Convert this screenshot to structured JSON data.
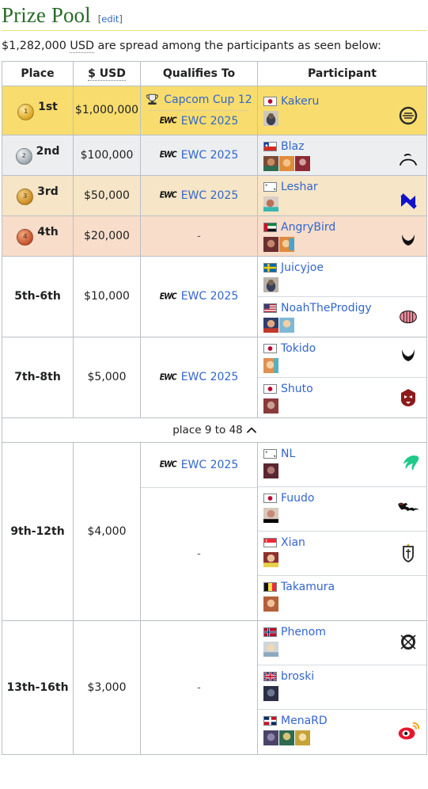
{
  "heading": {
    "title": "Prize Pool",
    "edit_open": "[",
    "edit_label": "edit",
    "edit_close": "]"
  },
  "intro": {
    "amount": "$1,282,000",
    "currency_abbr": "USD",
    "text_after": " are spread among the participants as seen below:"
  },
  "table": {
    "headers": {
      "place": "Place",
      "usd": "$ USD",
      "qualifies": "Qualifies To",
      "participant": "Participant"
    },
    "rows": [
      {
        "place": "1st",
        "medal": "gold-medal-icon",
        "prize": "$1,000,000",
        "qualifies": [
          {
            "label": "Capcom Cup 12",
            "icon": "trophy-icon"
          },
          {
            "label": "EWC 2025",
            "icon": "ewc-icon"
          }
        ],
        "participants": [
          {
            "name": "Kakeru",
            "flag": "japan-flag",
            "team_logo": "tsm-ring-logo",
            "characters": 1
          }
        ]
      },
      {
        "place": "2nd",
        "medal": "silver-medal-icon",
        "prize": "$100,000",
        "qualifies": [
          {
            "label": "EWC 2025",
            "icon": "ewc-icon"
          }
        ],
        "participants": [
          {
            "name": "Blaz",
            "flag": "chile-flag",
            "team_logo": "arc-logo",
            "characters": 3
          }
        ]
      },
      {
        "place": "3rd",
        "medal": "bronze-medal-icon",
        "prize": "$50,000",
        "qualifies": [
          {
            "label": "EWC 2025",
            "icon": "ewc-icon"
          }
        ],
        "participants": [
          {
            "name": "Leshar",
            "flag": "south-korea-flag",
            "team_logo": "blue-x-logo",
            "characters": 1
          }
        ]
      },
      {
        "place": "4th",
        "medal": "copper-medal-icon",
        "prize": "$20,000",
        "qualifies": [],
        "qualifies_dash": "-",
        "participants": [
          {
            "name": "AngryBird",
            "flag": "uae-flag",
            "team_logo": "horns-logo",
            "characters": 2
          }
        ]
      },
      {
        "place": "5th-6th",
        "prize": "$10,000",
        "qualifies": [
          {
            "label": "EWC 2025",
            "icon": "ewc-icon"
          }
        ],
        "participants": [
          {
            "name": "Juicyjoe",
            "flag": "sweden-flag",
            "team_logo": "",
            "characters": 1
          },
          {
            "name": "NoahTheProdigy",
            "flag": "usa-flag",
            "team_logo": "brain-logo",
            "characters": 2
          }
        ]
      },
      {
        "place": "7th-8th",
        "prize": "$5,000",
        "qualifies": [
          {
            "label": "EWC 2025",
            "icon": "ewc-icon"
          }
        ],
        "participants": [
          {
            "name": "Tokido",
            "flag": "japan-flag",
            "team_logo": "horns-logo",
            "characters": 1
          },
          {
            "name": "Shuto",
            "flag": "japan-flag",
            "team_logo": "red-wolf-logo",
            "characters": 1
          }
        ]
      }
    ],
    "collapse_toggle": {
      "label": "place 9 to 48",
      "icon": "chevron-up-icon"
    },
    "rows_expanded": [
      {
        "place": "9th-12th",
        "prize": "$4,000",
        "qualifies_first": {
          "label": "EWC 2025",
          "icon": "ewc-icon"
        },
        "qualifies_rest_dash": "-",
        "participants": [
          {
            "name": "NL",
            "flag": "south-korea-flag",
            "team_logo": "green-phoenix-logo",
            "characters": 1,
            "qualified": true
          },
          {
            "name": "Fuudo",
            "flag": "japan-flag",
            "team_logo": "beast-wordmark-logo",
            "characters": 1
          },
          {
            "name": "Xian",
            "flag": "singapore-flag",
            "team_logo": "helmet-logo",
            "characters": 1
          },
          {
            "name": "Takamura",
            "flag": "belgium-flag",
            "team_logo": "",
            "characters": 1
          }
        ]
      },
      {
        "place": "13th-16th",
        "prize": "$3,000",
        "qualifies_dash": "-",
        "participants": [
          {
            "name": "Phenom",
            "flag": "norway-flag",
            "team_logo": "ninja-swirl-logo",
            "characters": 1
          },
          {
            "name": "broski",
            "flag": "uk-flag",
            "team_logo": "",
            "characters": 1
          },
          {
            "name": "MenaRD",
            "flag": "dominican-republic-flag",
            "team_logo": "weibo-eye-logo",
            "characters": 3
          }
        ]
      }
    ]
  },
  "colors": {
    "link": "#3366cc",
    "heading": "#2a6b2a",
    "gold_row": "#f8dd6e",
    "silver_row": "#eceef0",
    "bronze_row": "#f6e5c6",
    "copper_row": "#f7ddca"
  }
}
